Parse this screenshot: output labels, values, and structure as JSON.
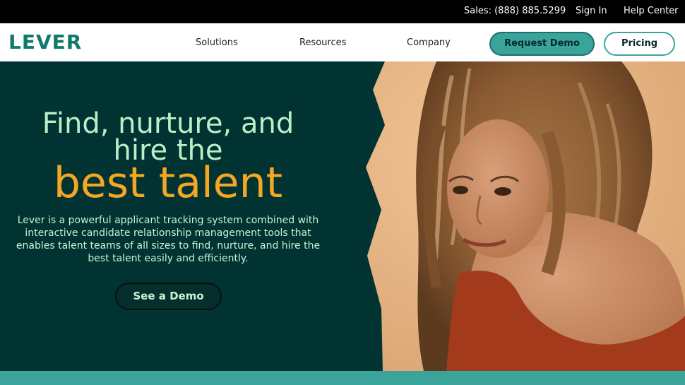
{
  "topbar": {
    "sales": "Sales: (888) 885.5299",
    "sign_in": "Sign In",
    "help_center": "Help Center"
  },
  "nav": {
    "logo": "LEVER",
    "links": [
      "Solutions",
      "Resources",
      "Company"
    ],
    "request_demo": "Request Demo",
    "pricing": "Pricing"
  },
  "hero": {
    "headline_line1": "Find, nurture, and",
    "headline_line2": "hire the",
    "headline_highlight": "best talent",
    "description": "Lever is a powerful applicant tracking system combined with interactive candidate relationship management tools that enables talent teams of all sizes to find, nurture, and hire the best talent easily and efficiently.",
    "cta": "See a Demo"
  },
  "colors": {
    "brand_teal": "#0f7a6a",
    "hero_bg": "#023333",
    "accent_orange": "#f5a623",
    "mint_text": "#b9f0c6",
    "button_teal": "#3aa39a"
  }
}
